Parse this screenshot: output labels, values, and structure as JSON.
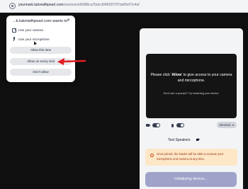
{
  "browser": {
    "url_host": "yourmark.tutorwithpearl.com",
    "url_path": "/sessions/d6988ca7bdcc849f2872f7daf0e07e4af"
  },
  "permission_popup": {
    "title": "...k.tutorwithpearl.com wants to",
    "close_glyph": "✕",
    "use_camera": "Use your camera",
    "use_microphone": "Use your microphone",
    "allow_this_time": "Allow this time",
    "allow_every_visit": "Allow on every visit",
    "dont_allow": "Don't allow"
  },
  "annotation": {
    "arrow_color": "#e11d22"
  },
  "panel": {
    "video_message_pre": "Please click '",
    "video_message_bold": "Allow",
    "video_message_post": "' to give access to your camera and microphone.",
    "video_hint": "Don't see a prompt? Try restarting your device.",
    "camera_toggle_on": true,
    "mic_toggle_on": true,
    "devices_label": "Devices",
    "test_speakers": "Test Speakers",
    "notice": "Once joined, the leader will be able to unmute your microphone and camera at any time.",
    "init_button": "Initializing device...",
    "accent_color": "#9fa3c9",
    "notice_color": "#fde7c7"
  }
}
